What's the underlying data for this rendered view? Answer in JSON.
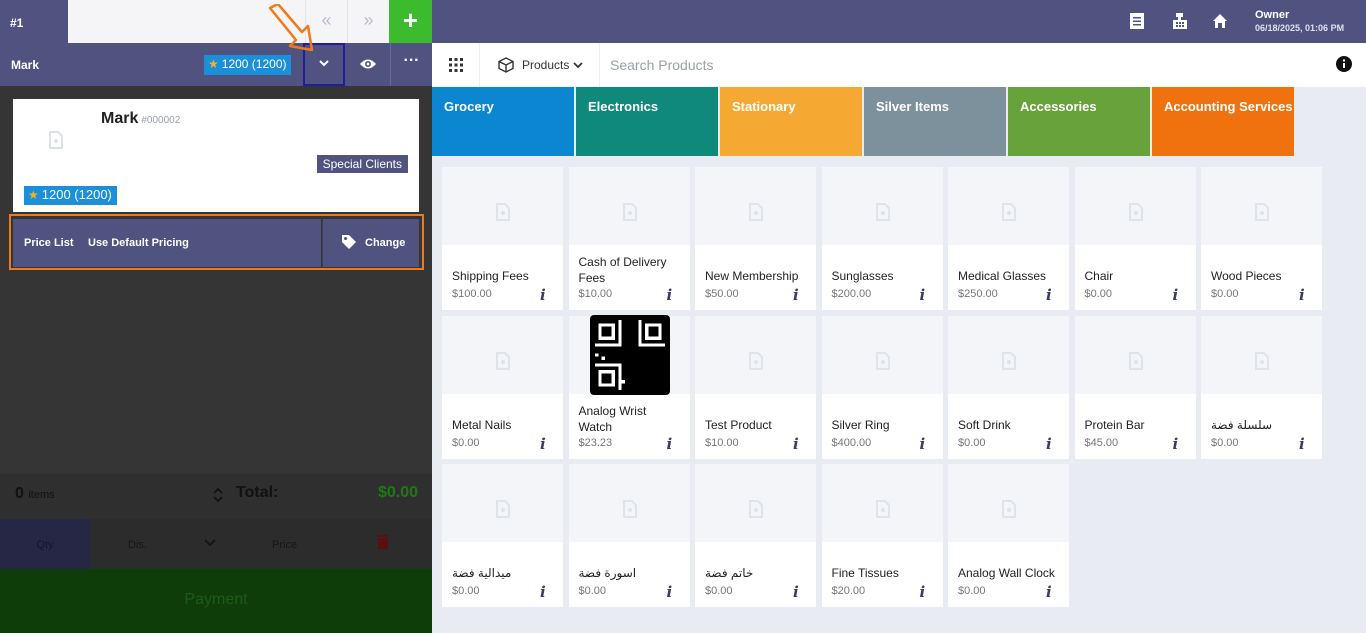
{
  "session": {
    "tab_label": "#1",
    "prev_glyph": "«",
    "next_glyph": "»",
    "add_glyph": "+"
  },
  "customer_bar": {
    "name": "Mark",
    "points": "1200 (1200)",
    "more_glyph": "···"
  },
  "customer_card": {
    "name": "Mark",
    "id": "#000002",
    "group": "Special Clients",
    "points": "1200 (1200)"
  },
  "price_list": {
    "label": "Price List",
    "value": "Use Default Pricing",
    "change_label": "Change"
  },
  "cart": {
    "items_count": "0",
    "items_label": "items",
    "total_label": "Total:",
    "total_value": "$0.00",
    "columns": {
      "qty": "Qty",
      "dis": "Dis.",
      "price": "Price"
    },
    "payment_label": "Payment"
  },
  "topbar": {
    "owner_name": "Owner",
    "datetime": "06/18/2025, 01:06 PM"
  },
  "search": {
    "dropdown_label": "Products",
    "placeholder": "Search Products"
  },
  "categories": [
    {
      "name": "Grocery",
      "color": "#0b86d0"
    },
    {
      "name": "Electronics",
      "color": "#0f8a7a"
    },
    {
      "name": "Stationary",
      "color": "#f5a832"
    },
    {
      "name": "Silver Items",
      "color": "#7c919b"
    },
    {
      "name": "Accessories",
      "color": "#67a23a"
    },
    {
      "name": "Accounting Services",
      "color": "#f0720e"
    }
  ],
  "products": [
    {
      "name": "Shipping Fees",
      "price": "$100.00"
    },
    {
      "name": "Cash of Delivery Fees",
      "price": "$10.00"
    },
    {
      "name": "New Membership",
      "price": "$50.00"
    },
    {
      "name": "Sunglasses",
      "price": "$200.00"
    },
    {
      "name": "Medical Glasses",
      "price": "$250.00"
    },
    {
      "name": "Chair",
      "price": "$0.00"
    },
    {
      "name": "Wood Pieces",
      "price": "$0.00"
    },
    {
      "name": "Metal Nails",
      "price": "$0.00"
    },
    {
      "name": "Analog Wrist Watch",
      "price": "$23.23"
    },
    {
      "name": "Test Product",
      "price": "$10.00"
    },
    {
      "name": "Silver Ring",
      "price": "$400.00"
    },
    {
      "name": "Soft Drink",
      "price": "$0.00"
    },
    {
      "name": "Protein Bar",
      "price": "$45.00"
    },
    {
      "name": "سلسلة فضة",
      "price": "$0.00"
    },
    {
      "name": "ميدالية فضة",
      "price": "$0.00"
    },
    {
      "name": "اسورة فضة",
      "price": "$0.00"
    },
    {
      "name": "خاتم فضة",
      "price": "$0.00"
    },
    {
      "name": "Fine Tissues",
      "price": "$20.00"
    },
    {
      "name": "Analog Wall Clock",
      "price": "$0.00"
    }
  ],
  "info_glyph": "i",
  "colors": {
    "primary": "#505280",
    "add": "#3dbb2e",
    "points": "#1b8fd9",
    "annotation": "#f07a1a"
  }
}
